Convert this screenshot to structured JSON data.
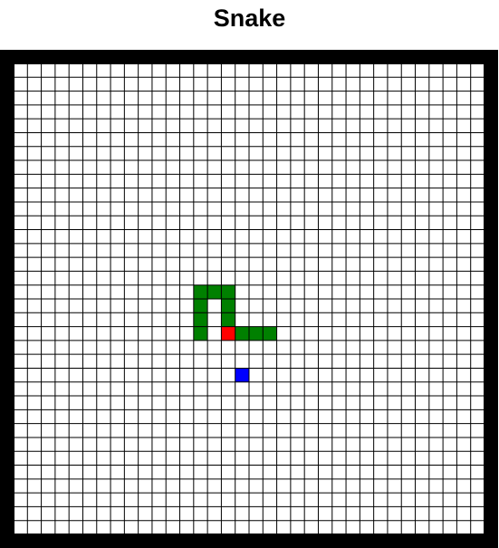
{
  "title": "Snake",
  "board": {
    "cols": 34,
    "rows": 34,
    "colors": {
      "snake_body": "#008000",
      "snake_head": "#ff0000",
      "food": "#0000ff",
      "grid_line": "#000000",
      "cell_bg": "#ffffff",
      "border": "#000000"
    },
    "snake_head": [
      15,
      19
    ],
    "snake_body": [
      [
        16,
        19
      ],
      [
        17,
        19
      ],
      [
        18,
        19
      ],
      [
        13,
        19
      ],
      [
        13,
        18
      ],
      [
        13,
        17
      ],
      [
        13,
        16
      ],
      [
        14,
        16
      ],
      [
        15,
        16
      ],
      [
        15,
        17
      ],
      [
        15,
        18
      ]
    ],
    "food": [
      16,
      22
    ]
  }
}
